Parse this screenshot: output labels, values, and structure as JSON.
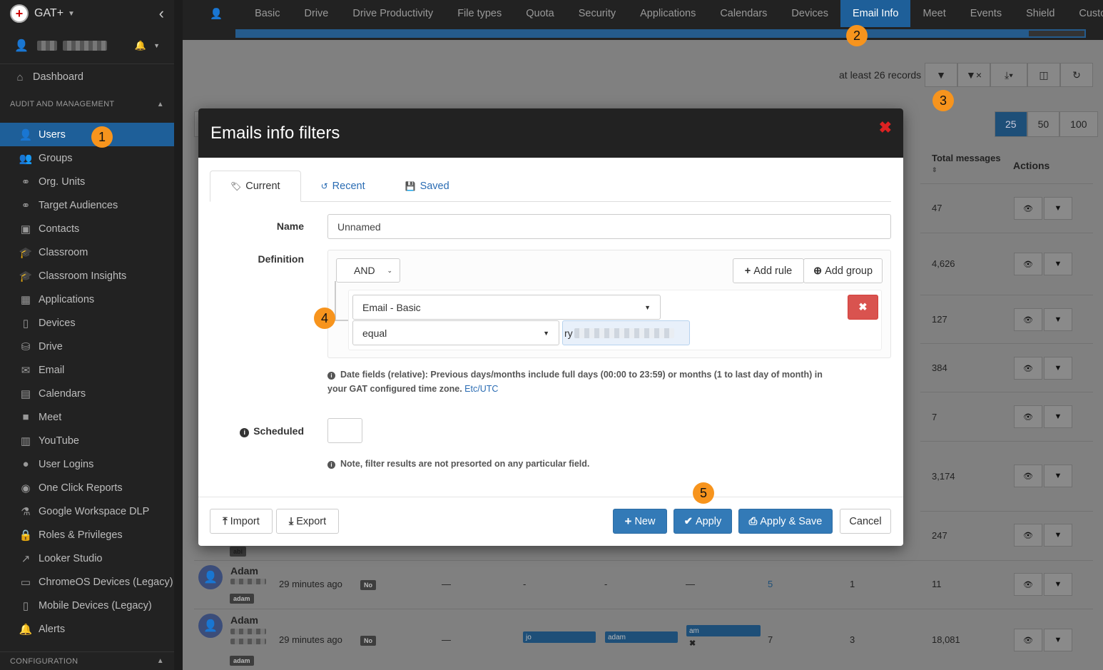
{
  "app": {
    "title": "GAT+"
  },
  "sidebar": {
    "section_audit": "AUDIT AND MANAGEMENT",
    "section_config": "CONFIGURATION",
    "dashboard": "Dashboard",
    "items": [
      {
        "label": "Users",
        "icon": "user-icon"
      },
      {
        "label": "Groups",
        "icon": "groups-icon"
      },
      {
        "label": "Org. Units",
        "icon": "sitemap-icon"
      },
      {
        "label": "Target Audiences",
        "icon": "sitemap-icon"
      },
      {
        "label": "Contacts",
        "icon": "contacts-icon"
      },
      {
        "label": "Classroom",
        "icon": "graduation-cap-icon"
      },
      {
        "label": "Classroom Insights",
        "icon": "graduation-cap-icon"
      },
      {
        "label": "Applications",
        "icon": "grid-icon"
      },
      {
        "label": "Devices",
        "icon": "mobile-icon"
      },
      {
        "label": "Drive",
        "icon": "drive-icon"
      },
      {
        "label": "Email",
        "icon": "envelope-icon"
      },
      {
        "label": "Calendars",
        "icon": "calendar-icon"
      },
      {
        "label": "Meet",
        "icon": "video-camera-icon"
      },
      {
        "label": "YouTube",
        "icon": "film-icon"
      },
      {
        "label": "User Logins",
        "icon": "globe-icon"
      },
      {
        "label": "One Click Reports",
        "icon": "eye-icon"
      },
      {
        "label": "Google Workspace DLP",
        "icon": "flask-icon"
      },
      {
        "label": "Roles & Privileges",
        "icon": "lock-icon"
      },
      {
        "label": "Looker Studio",
        "icon": "line-chart-icon"
      },
      {
        "label": "ChromeOS Devices (Legacy)",
        "icon": "laptop-icon"
      },
      {
        "label": "Mobile Devices (Legacy)",
        "icon": "mobile-icon"
      },
      {
        "label": "Alerts",
        "icon": "bell-icon"
      }
    ]
  },
  "topnav": {
    "tabs": [
      "Basic",
      "Drive",
      "Drive Productivity",
      "File types",
      "Quota",
      "Security",
      "Applications",
      "Calendars",
      "Devices",
      "Email Info",
      "Meet",
      "Events",
      "Shield",
      "Custon"
    ],
    "active": "Email Info"
  },
  "toolbar": {
    "records_text": "at least 26 records"
  },
  "pager": [
    "25",
    "50",
    "100"
  ],
  "table": {
    "col_total": "Total messages",
    "col_actions": "Actions",
    "totals": [
      "47",
      "4,626",
      "127",
      "384",
      "7",
      "3,174",
      "247"
    ],
    "rows": [
      {
        "name": "Adam",
        "time": "29 minutes ago",
        "flag": "No",
        "c1": "—",
        "c2": "-",
        "c3": "-",
        "c4": "—",
        "n1": "5",
        "n2": "1",
        "total": "11",
        "email_prefix": "adam"
      },
      {
        "name": "Adam",
        "time": "29 minutes ago",
        "flag": "No",
        "c1": "—",
        "chip1": "jo",
        "chip2": "adam",
        "chip3": "am",
        "n1": "7",
        "n2": "3",
        "total": "18,081",
        "email_prefix": "adam"
      }
    ],
    "partial_email": "abi"
  },
  "modal": {
    "title": "Emails info filters",
    "tabs": [
      "Current",
      "Recent",
      "Saved"
    ],
    "name_label": "Name",
    "name_value": "Unnamed",
    "definition_label": "Definition",
    "condition": "AND",
    "add_rule": "Add rule",
    "add_group": "Add group",
    "field": "Email - Basic",
    "operator": "equal",
    "value_prefix": "ry",
    "note_dates": "Date fields (relative): Previous days/months include full days (00:00 to 23:59) or months (1 to last day of month) in your GAT configured time zone.",
    "timezone_link": "Etc/UTC",
    "scheduled_label": "Scheduled",
    "note_presort": "Note, filter results are not presorted on any particular field.",
    "buttons": {
      "import": "Import",
      "export": "Export",
      "new": "New",
      "apply": "Apply",
      "apply_save": "Apply & Save",
      "cancel": "Cancel"
    }
  },
  "annotations": [
    "1",
    "2",
    "3",
    "4",
    "5"
  ]
}
